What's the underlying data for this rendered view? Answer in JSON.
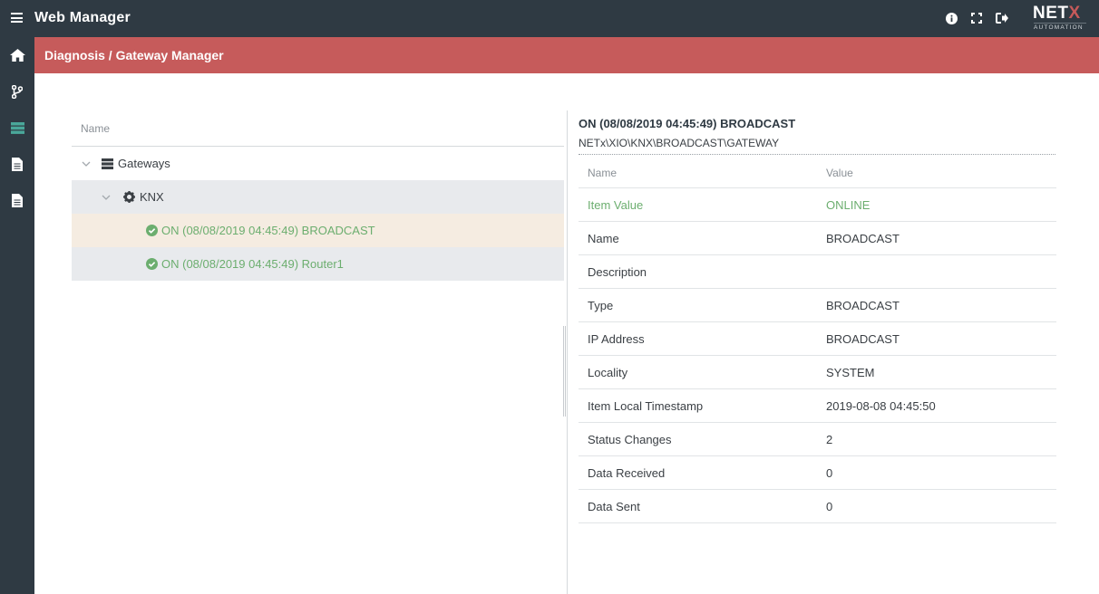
{
  "app": {
    "title": "Web Manager"
  },
  "brand": {
    "name_main": "NET",
    "name_x": "X",
    "tagline": "AUTOMATION"
  },
  "topbar": {
    "icons": [
      "info-icon",
      "fullscreen-icon",
      "logout-icon"
    ]
  },
  "sidebar": {
    "items": [
      {
        "name": "home",
        "icon": "home-icon",
        "active": false
      },
      {
        "name": "workflow",
        "icon": "branch-icon",
        "active": false
      },
      {
        "name": "diagnosis",
        "icon": "server-icon",
        "active": true
      },
      {
        "name": "document",
        "icon": "document-icon",
        "active": false
      },
      {
        "name": "document-2",
        "icon": "document-icon",
        "active": false
      }
    ]
  },
  "breadcrumb": "Diagnosis / Gateway Manager",
  "tree": {
    "header": "Name",
    "nodes": [
      {
        "label": "Gateways",
        "icon": "server-icon",
        "expanded": true
      },
      {
        "label": "KNX",
        "icon": "gear-icon",
        "expanded": true
      },
      {
        "label": "ON (08/08/2019 04:45:49) BROADCAST",
        "icon": "check-circle-icon",
        "status": "online",
        "selected": true
      },
      {
        "label": "ON (08/08/2019 04:45:49) Router1",
        "icon": "check-circle-icon",
        "status": "online",
        "selected": false
      }
    ]
  },
  "detail": {
    "title": "ON (08/08/2019 04:45:49) BROADCAST",
    "path": "NETx\\XIO\\KNX\\BROADCAST\\GATEWAY",
    "columns": {
      "name": "Name",
      "value": "Value"
    },
    "rows": [
      {
        "name": "Item Value",
        "value": "ONLINE"
      },
      {
        "name": "Name",
        "value": "BROADCAST"
      },
      {
        "name": "Description",
        "value": ""
      },
      {
        "name": "Type",
        "value": "BROADCAST"
      },
      {
        "name": "IP Address",
        "value": "BROADCAST"
      },
      {
        "name": "Locality",
        "value": "SYSTEM"
      },
      {
        "name": "Item Local Timestamp",
        "value": "2019-08-08 04:45:50"
      },
      {
        "name": "Status Changes",
        "value": "2"
      },
      {
        "name": "Data Received",
        "value": "0"
      },
      {
        "name": "Data Sent",
        "value": "0"
      }
    ]
  },
  "colors": {
    "topbar": "#2f3a43",
    "header_band": "#c65b5b",
    "status_ok": "#6cae6f",
    "sidebar_active": "#4aa79a",
    "selected_row": "#f5ece1",
    "alt_row": "#e8eaed"
  }
}
